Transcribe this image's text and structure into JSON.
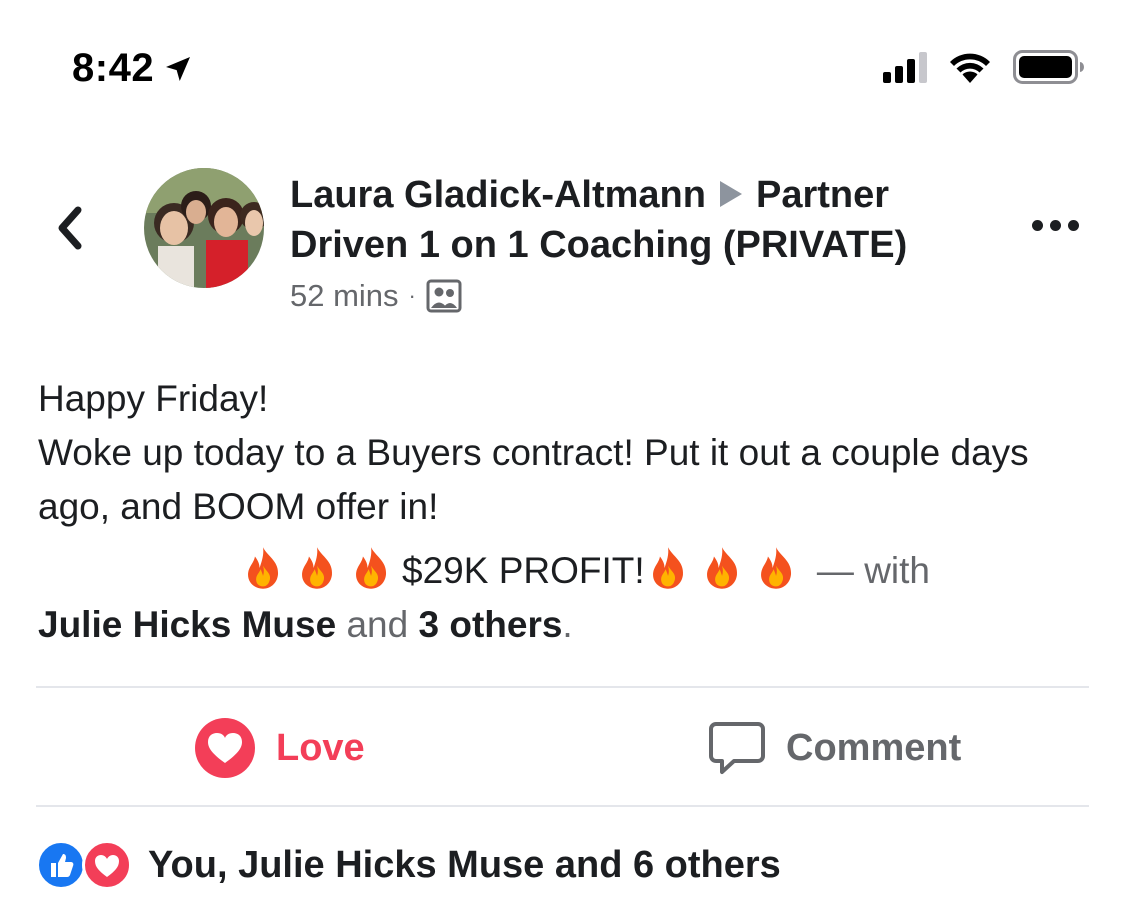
{
  "status_bar": {
    "time": "8:42"
  },
  "post": {
    "author": "Laura Gladick-Altmann",
    "group": "Partner Driven 1 on 1 Coaching (PRIVATE)",
    "timestamp": "52 mins",
    "meta_separator": "·",
    "privacy_icon": "group-members-icon",
    "body_lines": [
      "Happy Friday!",
      "Woke up today to a Buyers contract! Put it out a couple days ago, and BOOM offer in!"
    ],
    "profit_text": "$29K PROFIT!",
    "with_text": "— with",
    "tagged_name": "Julie Hicks Muse",
    "and_text": "and",
    "others_text": "3 others",
    "end_punct": "."
  },
  "actions": {
    "love_label": "Love",
    "comment_label": "Comment"
  },
  "reactions_summary": {
    "text": "You, Julie Hicks Muse and 6 others"
  },
  "colors": {
    "love": "#f33e58",
    "like": "#1877f2",
    "secondary_text": "#65676b",
    "primary_text": "#1c1e21"
  }
}
